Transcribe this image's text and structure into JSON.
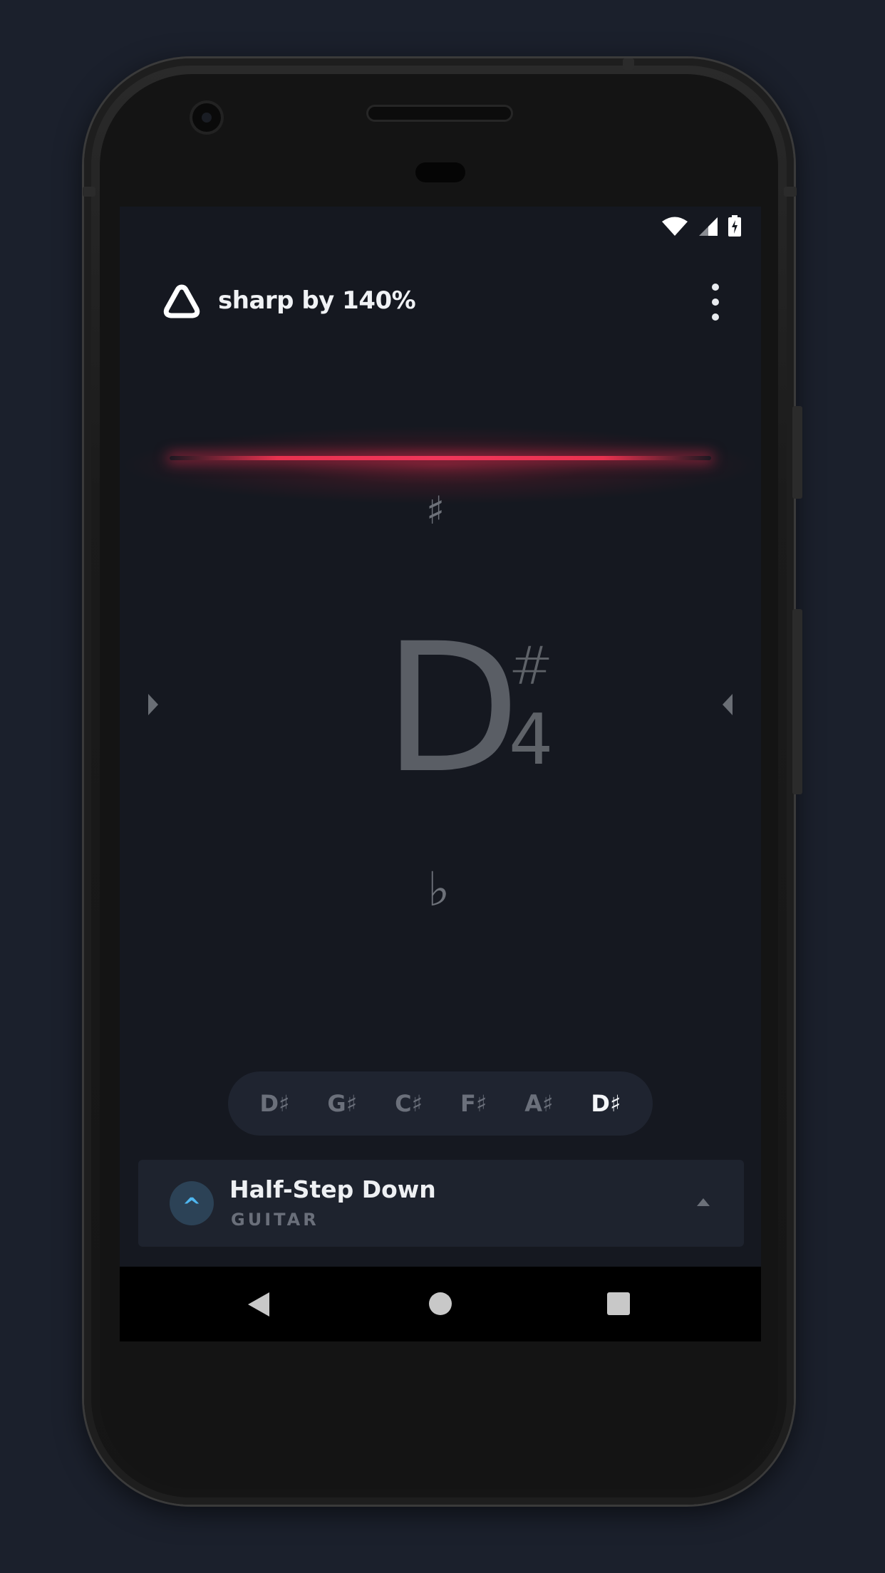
{
  "app": {
    "title": "sharp by 140%",
    "logo_icon": "triangle-logo-icon",
    "menu_icon": "more-vert-icon"
  },
  "status_bar": {
    "icons": [
      "wifi-icon",
      "cellular-signal-icon",
      "battery-charging-icon"
    ]
  },
  "meter": {
    "accent": "#e8324f",
    "sharp_symbol": "♯",
    "flat_symbol": "♭"
  },
  "note": {
    "letter": "D",
    "accidental": "#",
    "octave": "4"
  },
  "strings": {
    "items": [
      {
        "label": "D♯",
        "active": false
      },
      {
        "label": "G♯",
        "active": false
      },
      {
        "label": "C♯",
        "active": false
      },
      {
        "label": "F♯",
        "active": false
      },
      {
        "label": "A♯",
        "active": false
      },
      {
        "label": "D♯",
        "active": true
      }
    ]
  },
  "tuning": {
    "name": "Half-Step Down",
    "instrument": "GUITAR",
    "icon_glyph": "^",
    "icon_color": "#4fb7f0"
  },
  "navigation": {
    "back": "back-icon",
    "home": "home-icon",
    "recents": "recents-icon"
  }
}
